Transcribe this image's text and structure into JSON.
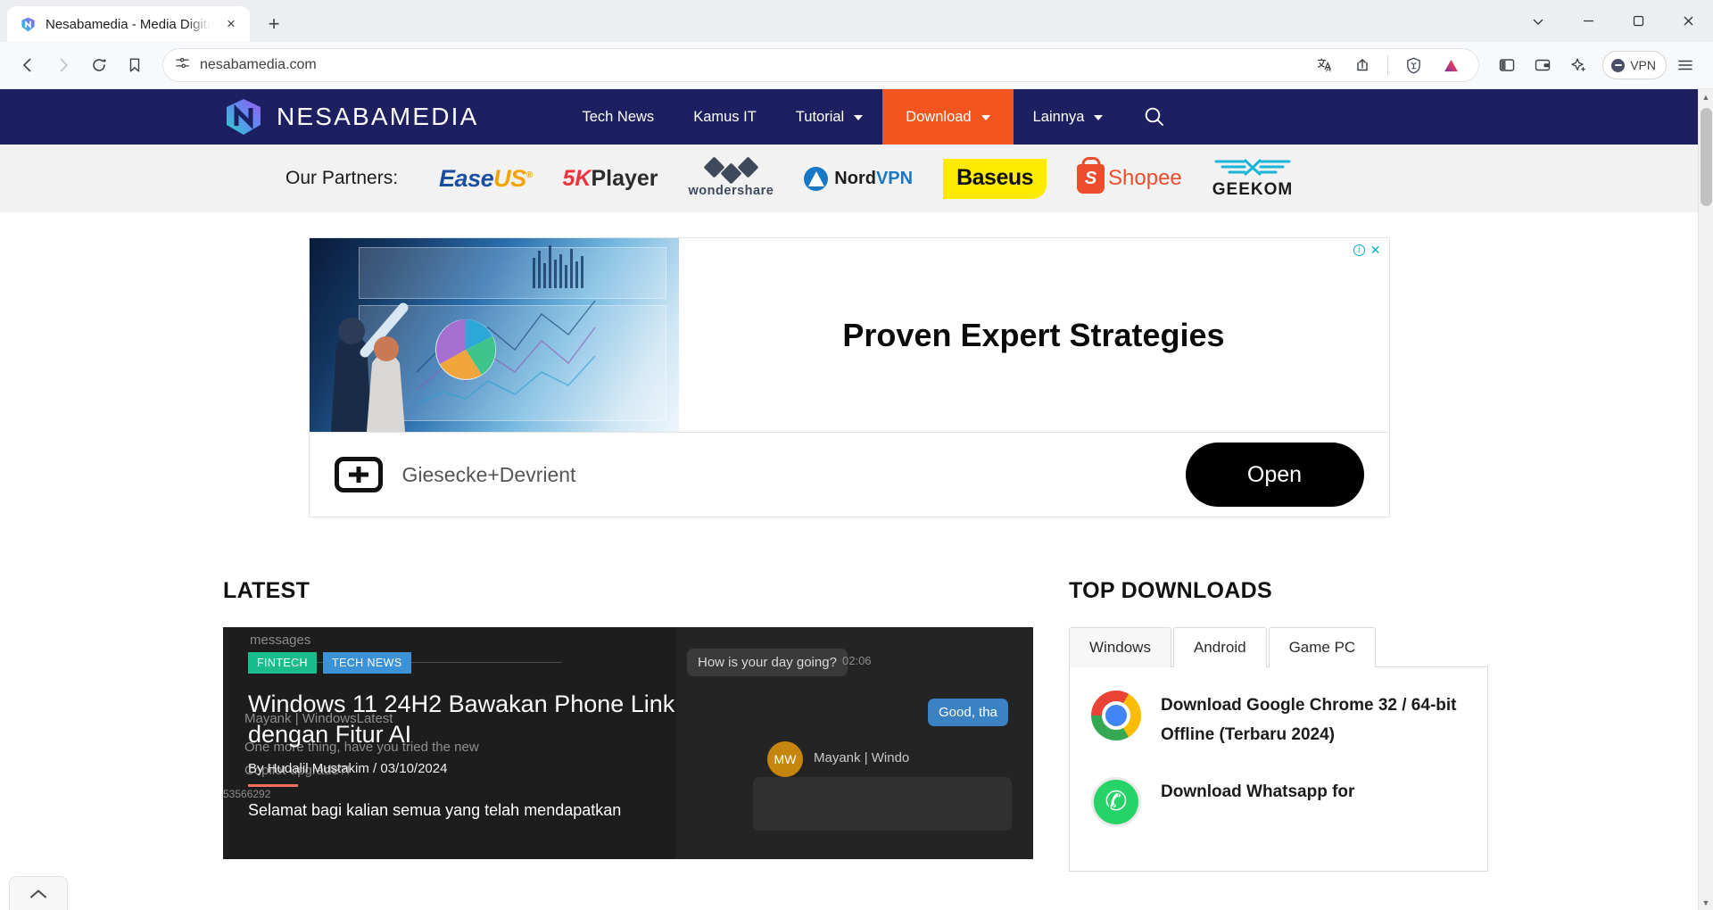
{
  "browser": {
    "tab": {
      "title": "Nesabamedia - Media Digital S",
      "favicon": "nesabamedia-logo-icon",
      "close": "×"
    },
    "new_tab_label": "+",
    "window_controls": {
      "minimize_all": "⌄",
      "minimize": "—",
      "maximize": "▭",
      "close": "✕"
    },
    "toolbar": {
      "back": "‹",
      "forward": "›",
      "reload": "⟳",
      "bookmark": "bookmark-icon",
      "site_info": "tune-icon",
      "url": "nesabamedia.com",
      "translate": "translate-icon",
      "share": "share-icon",
      "brave_shields": "brave-lion-icon",
      "brave_rewards": "brave-triangle-icon",
      "sidebar": "sidebar-panel-icon",
      "wallet": "wallet-icon",
      "leo_ai": "sparkle-icon",
      "vpn_label": "VPN",
      "menu": "hamburger-icon"
    },
    "scrollbar": {
      "up": "▲",
      "down": "▼"
    }
  },
  "site": {
    "brand": {
      "name": "NESABAMEDIA"
    },
    "nav": [
      {
        "label": "Tech News",
        "has_caret": false,
        "highlight": false
      },
      {
        "label": "Kamus IT",
        "has_caret": false,
        "highlight": false
      },
      {
        "label": "Tutorial",
        "has_caret": true,
        "highlight": false
      },
      {
        "label": "Download",
        "has_caret": true,
        "highlight": true
      },
      {
        "label": "Lainnya",
        "has_caret": true,
        "highlight": false
      }
    ],
    "search_icon": "search-icon",
    "partners": {
      "label": "Our Partners:",
      "items": [
        {
          "name": "EaseUS",
          "part_a": "Ease",
          "part_b": "US",
          "mark": "®"
        },
        {
          "name": "5KPlayer",
          "part_a": "5K",
          "part_b": "Player"
        },
        {
          "name": "Wondershare",
          "text": "wondershare"
        },
        {
          "name": "NordVPN",
          "part_a": "Nord",
          "part_b": "VPN"
        },
        {
          "name": "Baseus",
          "text": "Baseus"
        },
        {
          "name": "Shopee",
          "letter": "S",
          "text": "Shopee"
        },
        {
          "name": "GEEKOM",
          "text": "GEEKOM",
          "wings": "≡"
        }
      ]
    }
  },
  "ad": {
    "headline": "Proven Expert Strategies",
    "advertiser": "Giesecke+Devrient",
    "cta": "Open",
    "info_badge": "i",
    "close_badge": "✕"
  },
  "latest": {
    "title": "LATEST",
    "article": {
      "tags": [
        {
          "label": "FINTECH",
          "color": "#1abc8c"
        },
        {
          "label": "TECH NEWS",
          "color": "#3b92d6"
        }
      ],
      "title": "Windows 11 24H2 Bawakan Phone Link dengan Fitur AI",
      "byline": "By Hudalil Mustakim / 03/10/2024",
      "excerpt": "Selamat bagi kalian semua yang telah mendapatkan",
      "screenshot_texts": {
        "input_placeholder": "messages",
        "bubble_question": "How is your day going?",
        "bubble_reply": "Good, tha",
        "contact": "Mayank | WindowsLatest",
        "contact_short": "Mayank | Windo",
        "avatar_initials": "MW",
        "timestamp": "02:06",
        "line1": "One more thing, have you tried the new",
        "line2": "Copilot upgrade?!",
        "number": "53566292"
      }
    }
  },
  "top_downloads": {
    "title": "TOP DOWNLOADS",
    "tabs": [
      {
        "label": "Windows",
        "active": true
      },
      {
        "label": "Android",
        "active": false
      },
      {
        "label": "Game PC",
        "active": false
      }
    ],
    "items": [
      {
        "icon": "google-chrome-icon",
        "label": "Download Google Chrome 32 / 64-bit Offline (Terbaru 2024)"
      },
      {
        "icon": "whatsapp-icon",
        "label": "Download Whatsapp for"
      }
    ]
  },
  "back_to_top": {
    "icon": "chevron-up-icon"
  },
  "colors": {
    "nav_bg": "#1d2060",
    "nav_highlight": "#f4551e",
    "partners_bg": "#f2f2f2",
    "accent_rule": "#ef6f5c"
  }
}
